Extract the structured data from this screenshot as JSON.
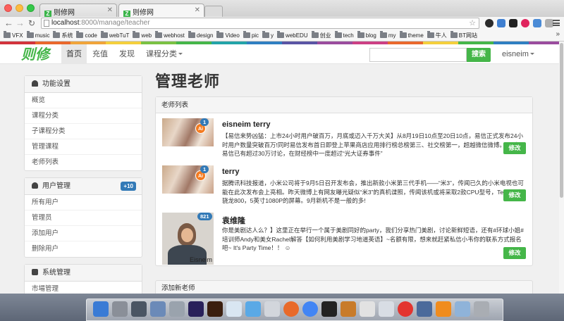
{
  "browser": {
    "tabs": [
      {
        "title": "则修网",
        "active": false
      },
      {
        "title": "则修网",
        "active": true
      }
    ],
    "url_host": "localhost",
    "url_path": ":8000/manage/teacher",
    "bookmarks": [
      "VFX",
      "music",
      "系统",
      "code",
      "webTuT",
      "web",
      "webhost",
      "design",
      "Video",
      "pic",
      "y",
      "webEDU",
      "创业",
      "tech",
      "blog",
      "my",
      "theme",
      "牛人",
      "BT网站"
    ],
    "bookmarks_more": "»"
  },
  "site": {
    "logo": "则修",
    "nav": [
      {
        "label": "首页",
        "active": true
      },
      {
        "label": "充值",
        "active": false
      },
      {
        "label": "发现",
        "active": false
      },
      {
        "label": "课程分类",
        "active": false,
        "dropdown": true
      }
    ],
    "search": {
      "placeholder": "",
      "button": "搜索"
    },
    "user": "eisneim",
    "brand_green": "#45b649",
    "colorbar": [
      "#d2333b",
      "#e9682c",
      "#f0a43a",
      "#f4cf3c",
      "#7ac143",
      "#45b649",
      "#23a3a8",
      "#2f7fc1",
      "#5a54a4",
      "#9a4c9e",
      "#cc3f84",
      "#e9682c",
      "#f4cf3c",
      "#45b649",
      "#2f7fc1",
      "#9a4c9e"
    ]
  },
  "sidebar": {
    "sections": [
      {
        "title": "功能设置",
        "icon": "dashboard-icon",
        "badge": "",
        "items": [
          "概览",
          "课程分类",
          "子课程分类",
          "管理课程",
          "老师列表"
        ]
      },
      {
        "title": "用户管理",
        "icon": "user-icon",
        "badge": "+10",
        "items": [
          "所有用户",
          "管理员",
          "添加用户",
          "删除用户"
        ]
      },
      {
        "title": "系统管理",
        "icon": "briefcase-icon",
        "badge": "",
        "items": [
          "市場管理"
        ]
      }
    ]
  },
  "main": {
    "page_title": "管理老师",
    "list_title": "老师列表",
    "edit_label": "修改",
    "teachers": [
      {
        "name": "eisneim terry",
        "count": "1",
        "desc": "【易信来势凶猛：上市24小时用户破百万，月底或迈入千万大关】从8月19日10点至20日10点，易信正式发布24小时用户数量突破百万!同时易信发布首日即登上苹果商店应用排行榜总榜第三、社交榜第一，超越微信微博。同时，易信已有超过30万讨论，在财经榜中一度超过“光大证券事件”",
        "thumb": "ai-poster"
      },
      {
        "name": "terry",
        "count": "1",
        "desc": "据腾讯科技报道，小米公司将于9月5日召开发布会，推出新款小米第三代手机——“米3”，传闻已久的小米电视也可能在此次发布会上亮相。昨天微博上有网友曝光疑似“米3”的真机谍照，传闻该机或将采取2款CPU型号，Tegra 4和骁龙800，5英寸1080P的屏幕。9月新机不是一般的多!",
        "thumb": "ai-poster"
      },
      {
        "name": "袁维隆",
        "count": "821",
        "desc": "你是美剧达人么？】这里正在举行一个属于美剧同好的party，我们分享热门美剧，讨论新鲜短语，还有#环球小姐#培训师Andy和美女Rachel解答【如何利用美剧学习地道英语】~名额有限，想来就赶紧私信小韦你的联系方式报名吧~ It's Party Time！！ ☺",
        "thumb": "photo",
        "photo_label": "Eisneim"
      }
    ],
    "add_title": "添加新老师"
  },
  "dock": {
    "colors": [
      "#3a7bd5",
      "#8a8f98",
      "#4a5563",
      "#6b8ab8",
      "#9aa3ad",
      "#29215a",
      "#3b1f0f",
      "#d9e6f2",
      "#5aa9e6",
      "#d2d6dc",
      "#e86a2a",
      "#4285f4",
      "#222",
      "#c87b2a",
      "#e2e2e2",
      "#d8dde4",
      "#e3342f",
      "#4b6a9b",
      "#f08c1e",
      "#8fb3d9",
      "#a9adb3"
    ]
  }
}
